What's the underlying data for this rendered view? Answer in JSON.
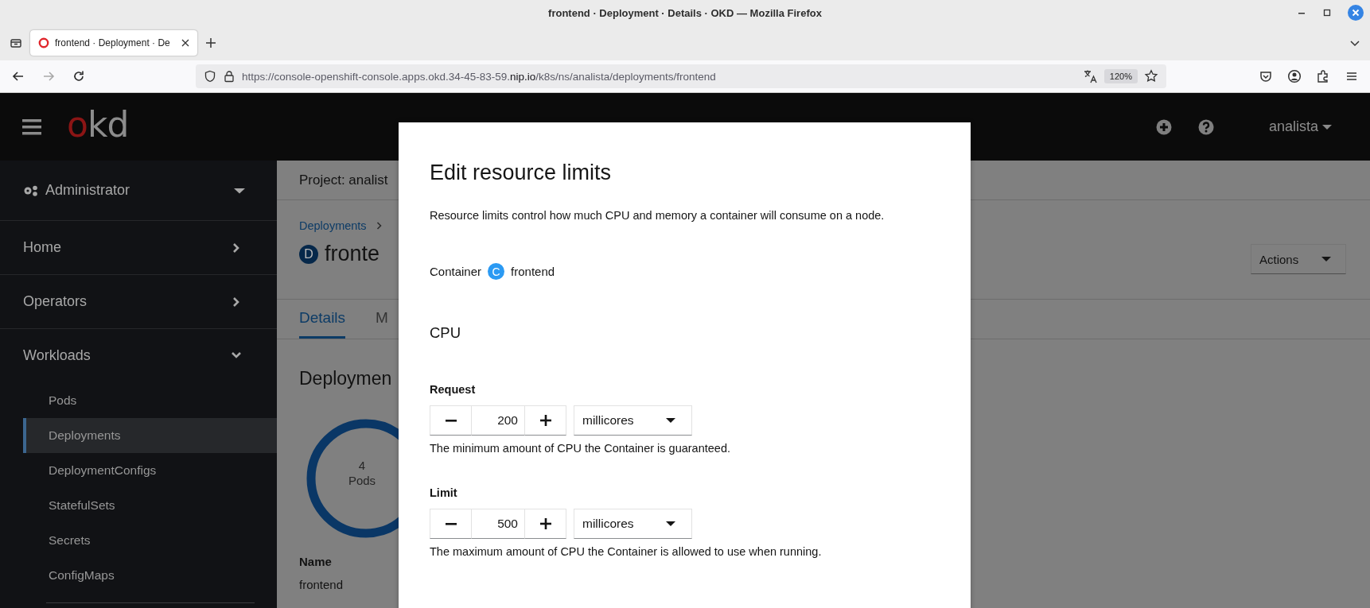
{
  "window": {
    "title": "frontend · Deployment · Details · OKD — Mozilla Firefox"
  },
  "browser": {
    "tabs": [
      {
        "label": "frontend · Deployment · De",
        "selected": true
      }
    ],
    "nav_buttons": [
      {
        "kind": "back",
        "disabled": false
      },
      {
        "kind": "forward",
        "disabled": true
      },
      {
        "kind": "reload",
        "disabled": false
      }
    ],
    "url": {
      "prefix": "https://console-openshift-console.apps.okd.34-45-83-59.",
      "domain": "nip.io",
      "path": "/k8s/ns/analista/deployments/frontend"
    },
    "zoom": "120%"
  },
  "masthead": {
    "logo": {
      "accent": "o",
      "rest": "kd"
    },
    "user": "analista"
  },
  "sidebar": {
    "perspective": "Administrator",
    "sections": [
      {
        "label": "Home",
        "expanded": false
      },
      {
        "label": "Operators",
        "expanded": false
      },
      {
        "label": "Workloads",
        "expanded": true,
        "children": [
          {
            "label": "Pods",
            "selected": false
          },
          {
            "label": "Deployments",
            "selected": true
          },
          {
            "label": "DeploymentConfigs",
            "selected": false
          },
          {
            "label": "StatefulSets",
            "selected": false
          },
          {
            "label": "Secrets",
            "selected": false
          },
          {
            "label": "ConfigMaps",
            "selected": false
          }
        ]
      }
    ]
  },
  "page": {
    "project": "Project: analist",
    "breadcrumb": [
      "Deployments"
    ],
    "title_badge": "D",
    "title": "fronte",
    "actions": "Actions",
    "tabs": [
      {
        "label": "Details",
        "selected": true
      },
      {
        "label": "M",
        "selected": false
      }
    ],
    "section_title": "Deploymen",
    "pods": {
      "count": "4",
      "unit": "Pods"
    },
    "fields": [
      {
        "label": "Name",
        "value": "frontend"
      }
    ]
  },
  "modal": {
    "title": "Edit resource limits",
    "description": "Resource limits control how much CPU and memory a container will consume on a node.",
    "container": {
      "label": "Container",
      "badge": "C",
      "name": "frontend"
    },
    "section": "CPU",
    "fields": [
      {
        "label": "Request",
        "value": "200",
        "unit": "millicores",
        "help": "The minimum amount of CPU the Container is guaranteed."
      },
      {
        "label": "Limit",
        "value": "500",
        "unit": "millicores",
        "help": "The maximum amount of CPU the Container is allowed to use when running."
      }
    ]
  }
}
